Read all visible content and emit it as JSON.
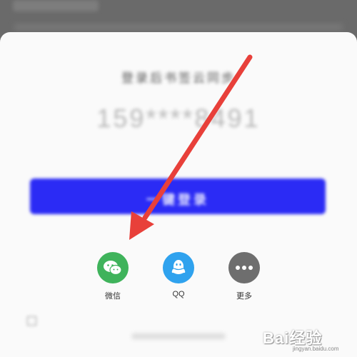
{
  "background": {
    "blurred_header": ""
  },
  "login": {
    "title": "登录后书签云同步",
    "phone": "159****8491",
    "hint": "",
    "button_label": "一键登录"
  },
  "share_options": [
    {
      "label": "微信",
      "icon": "wechat-icon",
      "color": "#3fb35b"
    },
    {
      "label": "QQ",
      "icon": "qq-icon",
      "color": "#2fa2ee"
    },
    {
      "label": "更多",
      "icon": "more-icon",
      "color": "#6e6e6e"
    }
  ],
  "agreement": {
    "text": ""
  },
  "annotation": {
    "arrow_color": "#e8403a"
  },
  "watermark": {
    "brand": "Bai经验",
    "url": "jingyan.baidu.com"
  }
}
